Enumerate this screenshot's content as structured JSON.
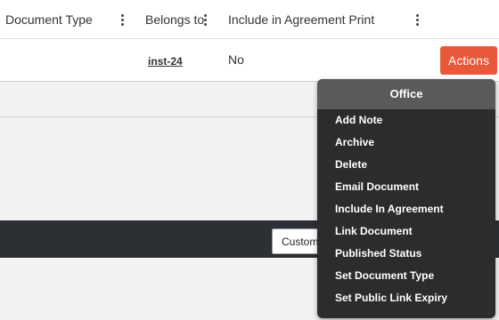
{
  "table": {
    "columns": [
      {
        "label": "Document Type"
      },
      {
        "label": "Belongs to"
      },
      {
        "label": "Include in Agreement Print"
      }
    ],
    "row": {
      "belongs_to": "inst-24",
      "include_in_print": "No",
      "actions_label": "Actions"
    }
  },
  "footer": {
    "customize_label": "Customize Report"
  },
  "actions_menu": {
    "header": "Office",
    "items": [
      "Add Note",
      "Archive",
      "Delete",
      "Email Document",
      "Include In Agreement",
      "Link Document",
      "Published Status",
      "Set Document Type",
      "Set Public Link Expiry"
    ]
  },
  "colors": {
    "accent": "#e8583a",
    "menu_bg": "#2c2c2c",
    "footer_bg": "#2c2f33"
  }
}
